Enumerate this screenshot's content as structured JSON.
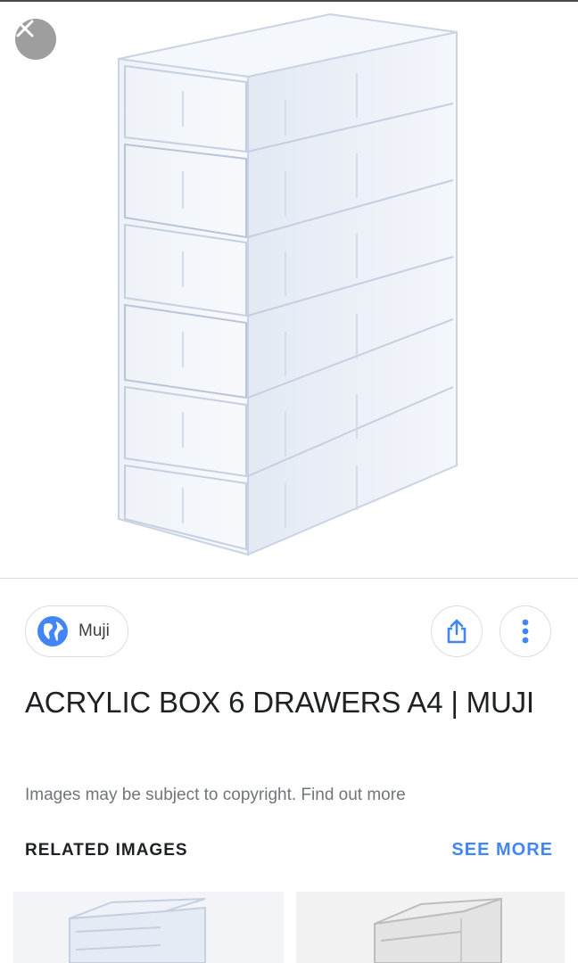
{
  "viewer": {
    "close_icon": "close-icon"
  },
  "source": {
    "name": "Muji",
    "icon": "globe-icon"
  },
  "actions": {
    "share_icon": "share-icon",
    "more_icon": "more-vertical-icon"
  },
  "result": {
    "title": "ACRYLIC BOX 6 DRAWERS A4 | MUJI",
    "copyright_notice": "Images may be subject to copyright. Find out more"
  },
  "related": {
    "header": "RELATED IMAGES",
    "see_more": "SEE MORE",
    "thumbnails": 2
  },
  "colors": {
    "accent": "#4285f4",
    "close_bg": "#9e9e9e",
    "text": "#202124",
    "muted": "#70757a"
  }
}
